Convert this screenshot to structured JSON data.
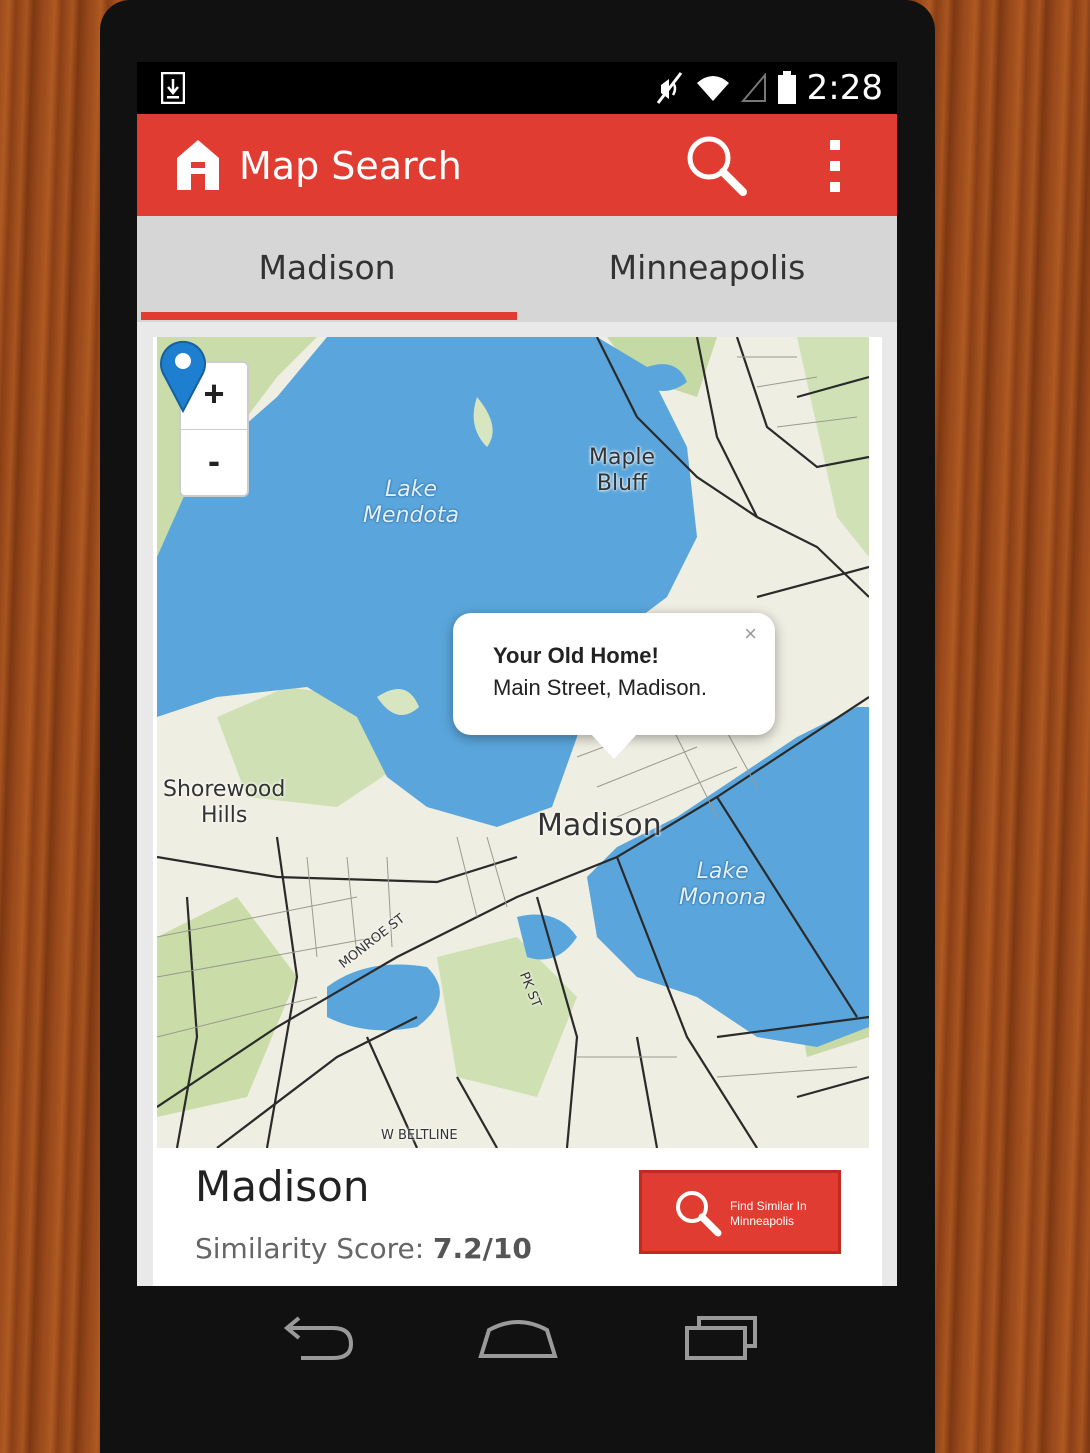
{
  "status_bar": {
    "time": "2:28",
    "icons": [
      "download-icon",
      "mute-icon",
      "wifi-icon",
      "signal-icon",
      "battery-icon"
    ]
  },
  "app_bar": {
    "title": "Map Search",
    "accent_color": "#e03c31"
  },
  "tabs": [
    {
      "label": "Madison",
      "selected": true
    },
    {
      "label": "Minneapolis",
      "selected": false
    }
  ],
  "map": {
    "zoom_in_label": "+",
    "zoom_out_label": "-",
    "labels": {
      "lake_mendota": "Lake\nMendota",
      "maple_bluff": "Maple\nBluff",
      "shorewood_hills": "Shorewood\nHills",
      "madison": "Madison",
      "lake_monona": "Lake\nMonona",
      "monroe_st": "MONROE ST",
      "park_st": "PK ST",
      "w_beltline": "W BELTLINE"
    },
    "popup": {
      "title": "Your Old Home!",
      "subtitle": "Main Street, Madison.",
      "close_label": "×"
    }
  },
  "result": {
    "city": "Madison",
    "score_label": "Similarity Score:",
    "score_value": "7.2/10",
    "find_button_label": "Find Similar In Minneapolis"
  },
  "nav_bar": {
    "icons": [
      "back-icon",
      "home-icon",
      "recents-icon"
    ]
  }
}
